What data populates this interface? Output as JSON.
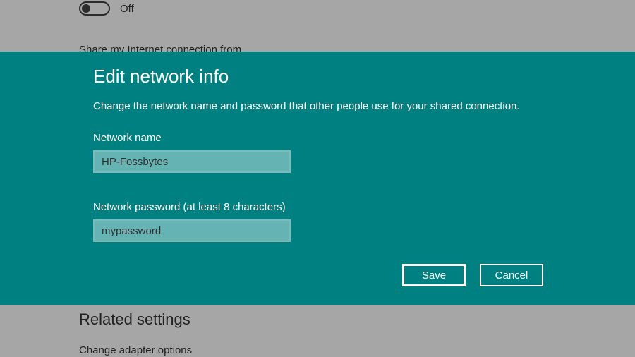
{
  "background": {
    "toggleState": "Off",
    "shareLabel": "Share my Internet connection from",
    "relatedHeading": "Related settings",
    "relatedLink": "Change adapter options"
  },
  "dialog": {
    "title": "Edit network info",
    "subtitle": "Change the network name and password that other people use for your shared connection.",
    "fields": {
      "nameLabel": "Network name",
      "nameValue": "HP-Fossbytes",
      "passwordLabel": "Network password (at least 8 characters)",
      "passwordValue": "mypassword"
    },
    "buttons": {
      "save": "Save",
      "cancel": "Cancel"
    }
  }
}
